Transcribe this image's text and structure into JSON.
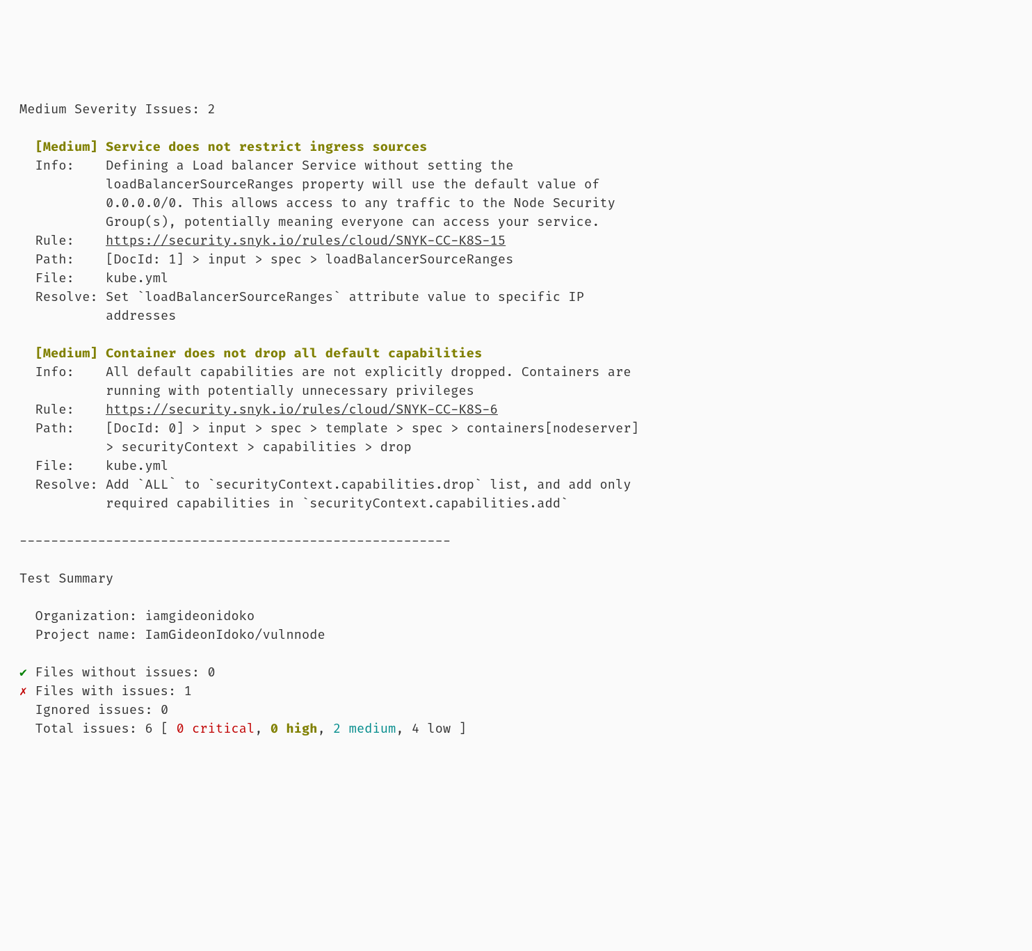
{
  "header": {
    "severity_label": "Medium Severity Issues:",
    "severity_count": "2"
  },
  "issues": [
    {
      "tag": "[Medium]",
      "title": "Service does not restrict ingress sources",
      "info_label": "Info:",
      "info_l1": "Defining a Load balancer Service without setting the",
      "info_l2": "loadBalancerSourceRanges property will use the default value of",
      "info_l3": "0.0.0.0/0. This allows access to any traffic to the Node Security",
      "info_l4": "Group(s), potentially meaning everyone can access your service.",
      "rule_label": "Rule:",
      "rule_url": "https://security.snyk.io/rules/cloud/SNYK-CC-K8S-15",
      "path_label": "Path:",
      "path_l1": "[DocId: 1] > input > spec > loadBalancerSourceRanges",
      "file_label": "File:",
      "file_value": "kube.yml",
      "resolve_label": "Resolve:",
      "resolve_l1": "Set `loadBalancerSourceRanges` attribute value to specific IP",
      "resolve_l2": "addresses"
    },
    {
      "tag": "[Medium]",
      "title": "Container does not drop all default capabilities",
      "info_label": "Info:",
      "info_l1": "All default capabilities are not explicitly dropped. Containers are",
      "info_l2": "running with potentially unnecessary privileges",
      "rule_label": "Rule:",
      "rule_url": "https://security.snyk.io/rules/cloud/SNYK-CC-K8S-6",
      "path_label": "Path:",
      "path_l1": "[DocId: 0] > input > spec > template > spec > containers[nodeserver]",
      "path_l2": "> securityContext > capabilities > drop",
      "file_label": "File:",
      "file_value": "kube.yml",
      "resolve_label": "Resolve:",
      "resolve_l1": "Add `ALL` to `securityContext.capabilities.drop` list, and add only",
      "resolve_l2": "required capabilities in `securityContext.capabilities.add`"
    }
  ],
  "divider": "-------------------------------------------------------",
  "summary": {
    "title": "Test Summary",
    "org_label": "Organization:",
    "org_value": "iamgideonidoko",
    "project_label": "Project name:",
    "project_value": "IamGideonIdoko/vulnnode",
    "files_ok_check": "✔",
    "files_ok_label": "Files without issues:",
    "files_ok_value": "0",
    "files_bad_cross": "✗",
    "files_bad_label": "Files with issues:",
    "files_bad_value": "1",
    "ignored_label": "Ignored issues:",
    "ignored_value": "0",
    "total_label": "Total issues:",
    "total_value": "6",
    "bracket_open": "[",
    "critical_count": "0 critical",
    "sep1": ",",
    "high_count": "0 high",
    "sep2": ",",
    "medium_count": "2 medium",
    "sep3": ",",
    "low_count": "4 low",
    "bracket_close": "]"
  }
}
